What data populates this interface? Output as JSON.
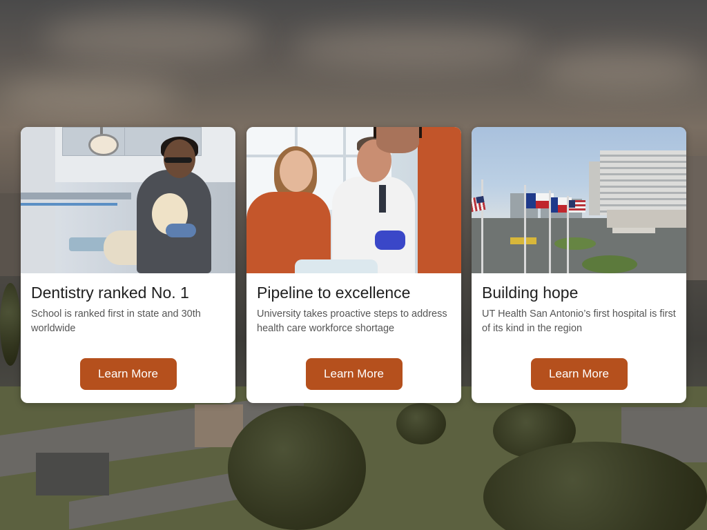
{
  "page": {
    "background_description_colors": {
      "sky": "#6d655c",
      "ground": "#4a4a40"
    }
  },
  "colors": {
    "button": "#b5501d",
    "button_text": "#ffffff",
    "card_bg": "#ffffff",
    "title": "#1f1f1f",
    "description": "#555555"
  },
  "cards": [
    {
      "title": "Dentistry ranked No. 1",
      "description": "School is ranked first in state and 30th worldwide",
      "button_label": "Learn More",
      "image_alt": "dentistry-lab-photo"
    },
    {
      "title": "Pipeline to excellence",
      "description": "University takes proactive steps to address health care workforce shortage",
      "button_label": "Learn More",
      "image_alt": "medical-students-photo"
    },
    {
      "title": "Building hope",
      "description": "UT Health San Antonio’s first hospital is first of its kind in the region",
      "button_label": "Learn More",
      "image_alt": "hospital-building-photo"
    }
  ]
}
